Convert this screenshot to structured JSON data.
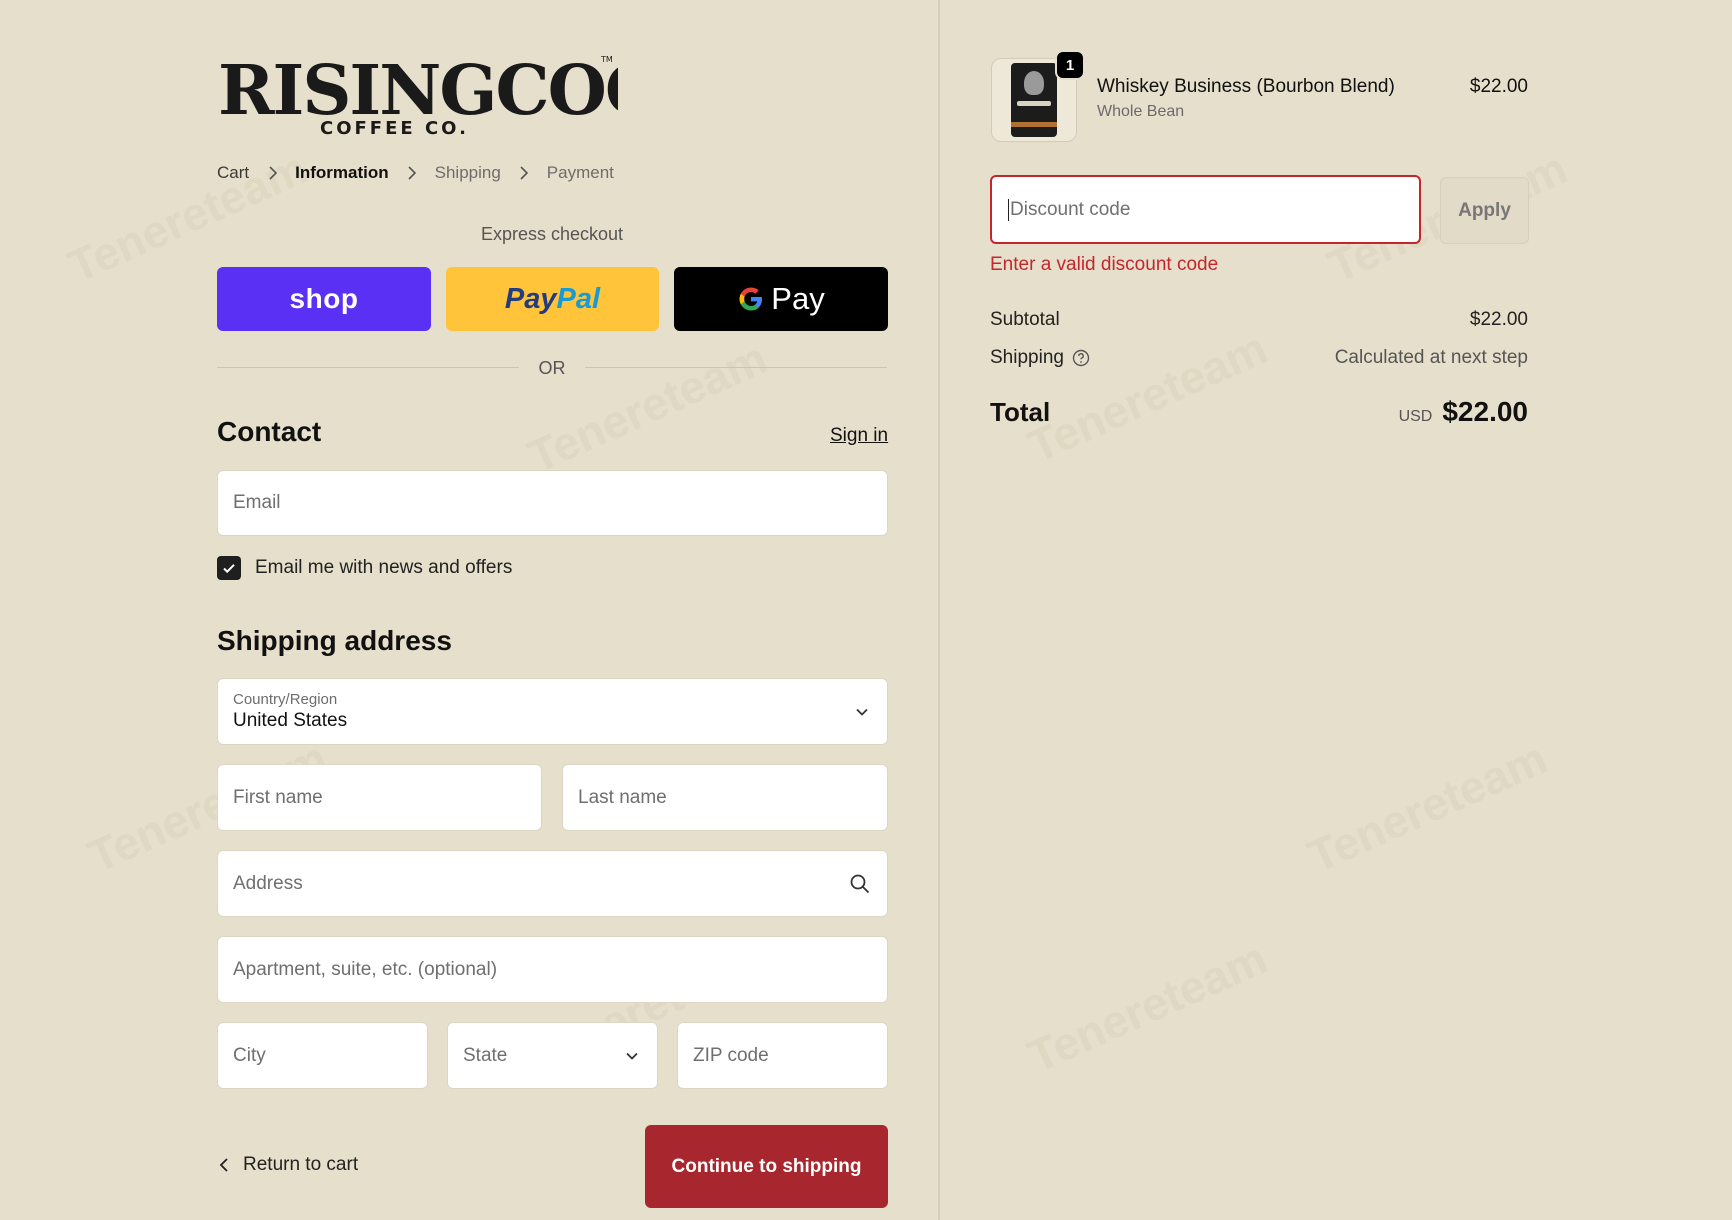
{
  "brand": {
    "name_main": "RISINGCOCK",
    "name_sub": "COFFEE CO.",
    "trademark": "TM"
  },
  "breadcrumb": [
    {
      "label": "Cart",
      "state": "link"
    },
    {
      "label": "Information",
      "state": "active"
    },
    {
      "label": "Shipping",
      "state": "muted"
    },
    {
      "label": "Payment",
      "state": "muted"
    }
  ],
  "express": {
    "title": "Express checkout",
    "shop_label": "shop",
    "paypal_label_a": "Pay",
    "paypal_label_b": "Pal",
    "gpay_label": "Pay",
    "or_label": "OR"
  },
  "contact": {
    "title": "Contact",
    "sign_in": "Sign in",
    "email_placeholder": "Email",
    "newsletter_label": "Email me with news and offers",
    "newsletter_checked": true
  },
  "shipping_address": {
    "title": "Shipping address",
    "country_label": "Country/Region",
    "country_value": "United States",
    "first_name_placeholder": "First name",
    "last_name_placeholder": "Last name",
    "address_placeholder": "Address",
    "apartment_placeholder": "Apartment, suite, etc. (optional)",
    "city_placeholder": "City",
    "state_placeholder": "State",
    "zip_placeholder": "ZIP code"
  },
  "footer": {
    "return_label": "Return to cart",
    "continue_label": "Continue to shipping"
  },
  "order": {
    "item": {
      "name": "Whiskey Business (Bourbon Blend)",
      "variant": "Whole Bean",
      "price": "$22.00",
      "quantity": "1"
    },
    "discount": {
      "placeholder": "Discount code",
      "apply_label": "Apply",
      "error": "Enter a valid discount code"
    },
    "subtotal_label": "Subtotal",
    "subtotal_value": "$22.00",
    "shipping_label": "Shipping",
    "shipping_value": "Calculated at next step",
    "total_label": "Total",
    "currency": "USD",
    "total_value": "$22.00"
  },
  "watermark": "Tenereteam",
  "colors": {
    "background": "#e6dfcb",
    "shop_pay": "#5a31f4",
    "paypal": "#ffc439",
    "gpay": "#000000",
    "primary_button": "#a8262d",
    "error": "#c4262e"
  }
}
